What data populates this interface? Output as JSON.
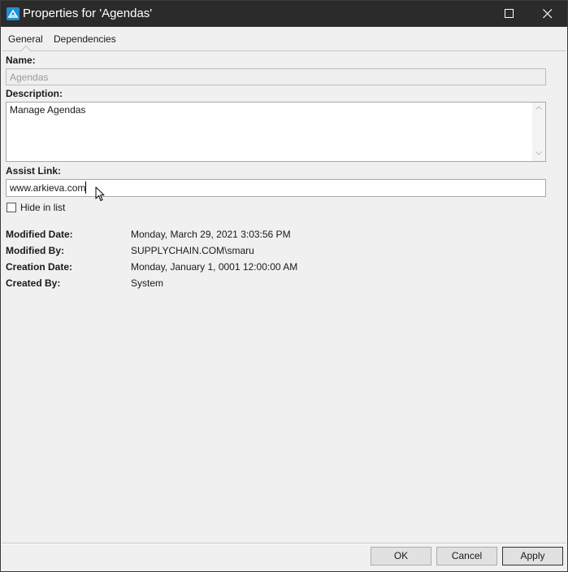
{
  "window": {
    "title": "Properties for 'Agendas'",
    "controls": {
      "maximize": "maximize-icon",
      "close": "close-icon"
    }
  },
  "tabs": [
    {
      "label": "General",
      "selected": true
    },
    {
      "label": "Dependencies",
      "selected": false
    }
  ],
  "form": {
    "name_label": "Name:",
    "name_value": "Agendas",
    "description_label": "Description:",
    "description_value": "Manage Agendas",
    "assist_label": "Assist Link:",
    "assist_value": "www.arkieva.com",
    "hide_in_list_label": "Hide in list",
    "hide_in_list_checked": false
  },
  "info": [
    {
      "key": "Modified Date:",
      "value": "Monday, March 29, 2021 3:03:56 PM"
    },
    {
      "key": "Modified By:",
      "value": "SUPPLYCHAIN.COM\\smaru"
    },
    {
      "key": "Creation Date:",
      "value": "Monday, January 1, 0001 12:00:00 AM"
    },
    {
      "key": "Created By:",
      "value": "System"
    }
  ],
  "buttons": {
    "ok": "OK",
    "cancel": "Cancel",
    "apply": "Apply"
  },
  "colors": {
    "titlebar": "#2b2b2b",
    "app_icon": "#1e8fd6",
    "dialog_bg": "#f0f0f0"
  }
}
